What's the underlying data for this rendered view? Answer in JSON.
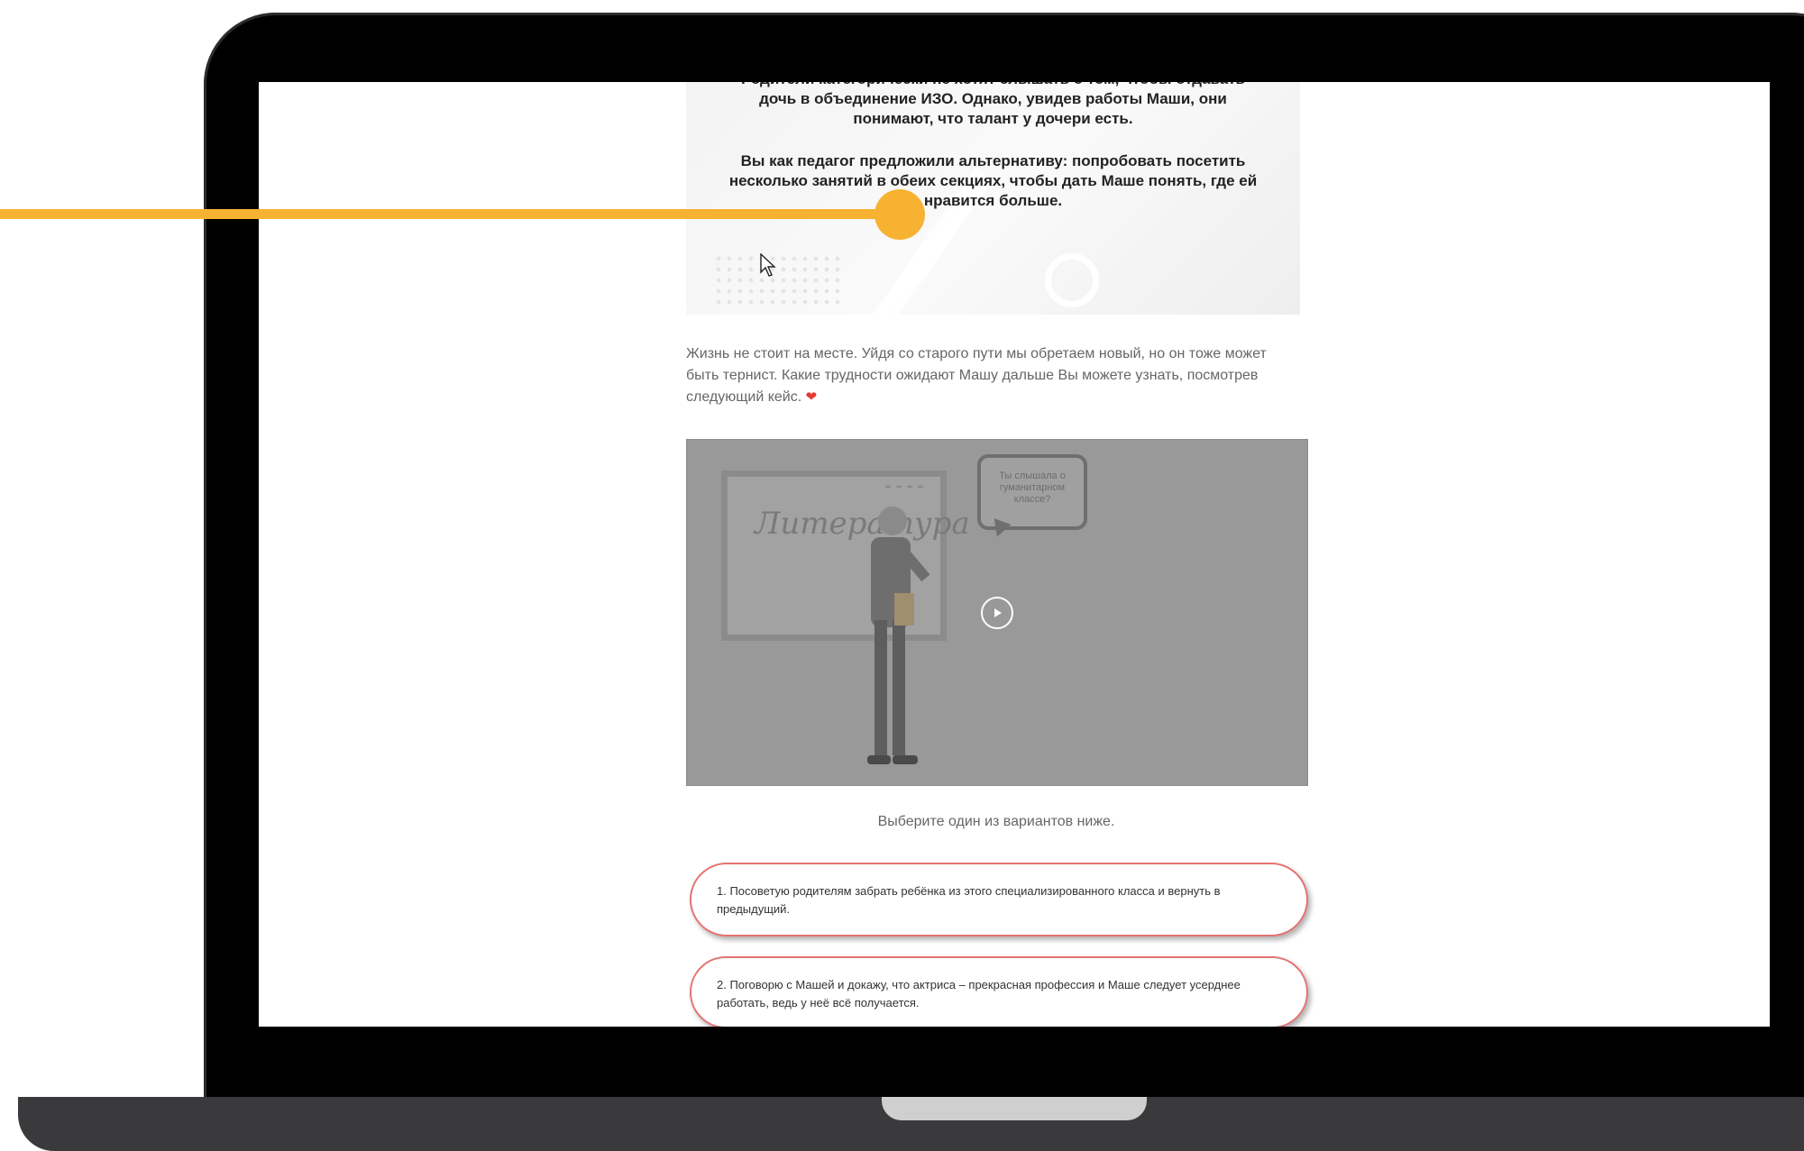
{
  "colors": {
    "accent_marker": "#f7b232",
    "option_border": "#e57373",
    "video_overlay": "#999999"
  },
  "case_card": {
    "paragraph_1": "Родители категорически не хотят слышать о том, чтобы отдавать дочь в объединение ИЗО. Однако, увидев работы Маши, они понимают, что талант у дочери есть.",
    "paragraph_2": "Вы как педагог предложили альтернативу: попробовать посетить несколько занятий в обеих секциях, чтобы дать Маше понять, где ей нравится больше."
  },
  "intro_text": "Жизнь не стоит на месте. Уйдя со старого пути мы обретаем новый, но он тоже может быть тернист. Какие трудности ожидают Машу дальше Вы можете узнать, посмотрев следующий кейс.",
  "heart_icon": "heart-icon",
  "video": {
    "board_word": "Литература",
    "bubble_text": "Ты слышала о гуманитарном классе?",
    "play_icon": "play-icon"
  },
  "prompt": "Выберите один из вариантов ниже.",
  "options": [
    {
      "label": "1. Посоветую родителям забрать ребёнка из этого специализированного класса и вернуть в предыдущий."
    },
    {
      "label": "2. Поговорю с Машей и докажу, что актриса – прекрасная профессия и Маше следует усерднее работать, ведь у неё всё получается."
    }
  ]
}
